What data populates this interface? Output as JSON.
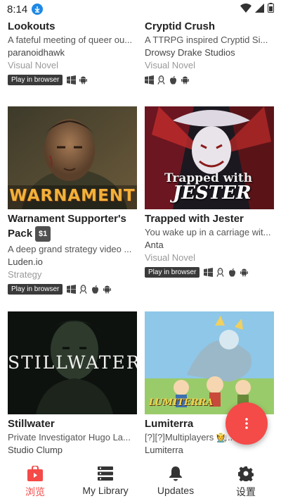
{
  "status_bar": {
    "time": "8:14"
  },
  "cards": [
    {
      "title": "Lookouts",
      "desc": "A fateful meeting of queer ou...",
      "author": "paranoidhawk",
      "genre": "Visual Novel",
      "browser_label": "Play in browser"
    },
    {
      "title": "Cryptid Crush",
      "desc": "A TTRPG inspired Cryptid Si...",
      "author": "Drowsy Drake Studios",
      "genre": "Visual Novel"
    },
    {
      "title": "Warnament Supporter's Pack",
      "price": "$1",
      "desc": "A deep grand strategy video ...",
      "author": "Luden.io",
      "genre": "Strategy",
      "browser_label": "Play in browser",
      "cover_text": "WARNAMENT"
    },
    {
      "title": "Trapped with Jester",
      "desc": "You wake up in a carriage wit...",
      "author": "Anta",
      "genre": "Visual Novel",
      "browser_label": "Play in browser",
      "cover_text_1": "Trapped with",
      "cover_text_2": "JESTER"
    },
    {
      "title": "Stillwater",
      "desc": "Private Investigator Hugo La...",
      "author": "Studio Clump",
      "cover_text": "STILLWATER"
    },
    {
      "title": "Lumiterra",
      "desc": "[?][?]Multiplayers 🧑‍🌾...",
      "author": "Lumiterra",
      "cover_text": "LUMITERRA"
    }
  ],
  "bottom_nav": [
    {
      "label": "浏览",
      "icon": "store-bag-icon"
    },
    {
      "label": "My Library",
      "icon": "library-list-icon"
    },
    {
      "label": "Updates",
      "icon": "bell-icon"
    },
    {
      "label": "设置",
      "icon": "gear-icon"
    }
  ],
  "colors": {
    "accent": "#f44a48",
    "tag_bg": "#3a3a3a"
  }
}
